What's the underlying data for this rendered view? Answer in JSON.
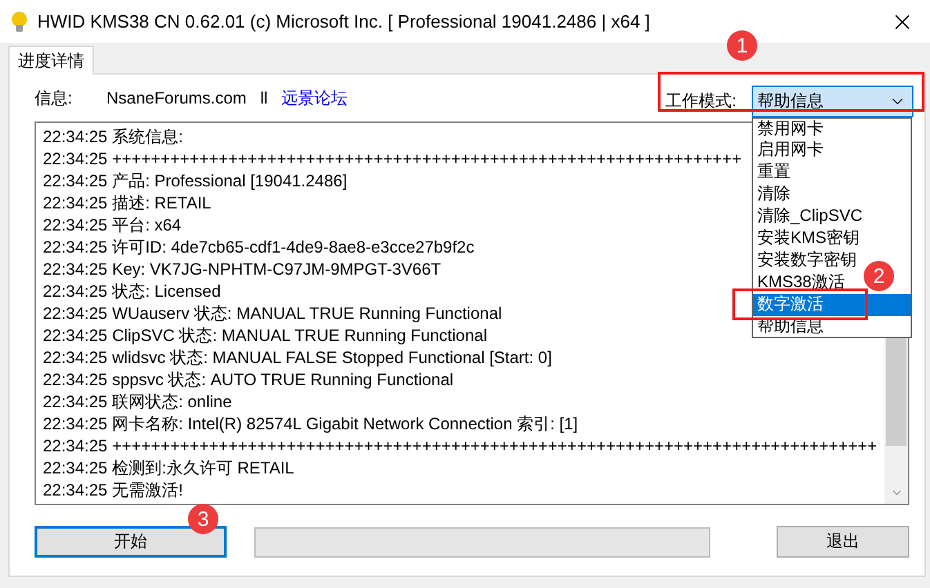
{
  "window": {
    "title": "HWID KMS38 CN 0.62.01 (c) Microsoft Inc. [ Professional 19041.2486 | x64 ]"
  },
  "tabs": [
    {
      "label": "进度详情",
      "selected": true
    }
  ],
  "info": {
    "label": "信息:",
    "site": "NsaneForums.com",
    "separator": "ll",
    "link": "远景论坛"
  },
  "mode": {
    "label": "工作模式:",
    "value": "帮助信息",
    "expanded": true,
    "options": [
      {
        "label": "禁用网卡",
        "highlighted": false
      },
      {
        "label": "启用网卡",
        "highlighted": false
      },
      {
        "label": "重置",
        "highlighted": false
      },
      {
        "label": "清除",
        "highlighted": false
      },
      {
        "label": "清除_ClipSVC",
        "highlighted": false
      },
      {
        "label": "安装KMS密钥",
        "highlighted": false
      },
      {
        "label": "安装数字密钥",
        "highlighted": false
      },
      {
        "label": "KMS38激活",
        "highlighted": false
      },
      {
        "label": "数字激活",
        "highlighted": true
      },
      {
        "label": "帮助信息",
        "highlighted": false
      }
    ]
  },
  "log": [
    {
      "time": "22:34:25",
      "text": "系统信息:"
    },
    {
      "time": "22:34:25",
      "text": "+++++++++++++++++++++++++++++++++++++++++++++++++++++++++++++++++"
    },
    {
      "time": "22:34:25",
      "text": "产品: Professional [19041.2486]"
    },
    {
      "time": "22:34:25",
      "text": "描述: RETAIL"
    },
    {
      "time": "22:34:25",
      "text": "平台: x64"
    },
    {
      "time": "22:34:25",
      "text": "许可ID: 4de7cb65-cdf1-4de9-8ae8-e3cce27b9f2c"
    },
    {
      "time": "22:34:25",
      "text": "Key: VK7JG-NPHTM-C97JM-9MPGT-3V66T"
    },
    {
      "time": "22:34:25",
      "text": "状态: Licensed"
    },
    {
      "time": "22:34:25",
      "text": "WUauserv 状态: MANUAL TRUE Running Functional"
    },
    {
      "time": "22:34:25",
      "text": "ClipSVC 状态: MANUAL TRUE Running Functional"
    },
    {
      "time": "22:34:25",
      "text": "wlidsvc 状态: MANUAL FALSE Stopped Functional [Start: 0]"
    },
    {
      "time": "22:34:25",
      "text": "sppsvc 状态: AUTO TRUE Running Functional"
    },
    {
      "time": "22:34:25",
      "text": "联网状态: online"
    },
    {
      "time": "22:34:25",
      "text": "网卡名称: Intel(R) 82574L Gigabit Network Connection 索引: [1]"
    },
    {
      "time": "22:34:25",
      "text": "+++++++++++++++++++++++++++++++++++++++++++++++++++++++++++++++++++++++++++++++"
    },
    {
      "time": "22:34:25",
      "text": "检测到:永久许可 RETAIL"
    },
    {
      "time": "22:34:25",
      "text": "无需激活!"
    }
  ],
  "progress": {
    "level": 0
  },
  "buttons": [
    {
      "label": "开始",
      "focused": true
    },
    {
      "label": "退出",
      "focused": false
    }
  ],
  "annotations": [
    "1",
    "2",
    "3"
  ]
}
